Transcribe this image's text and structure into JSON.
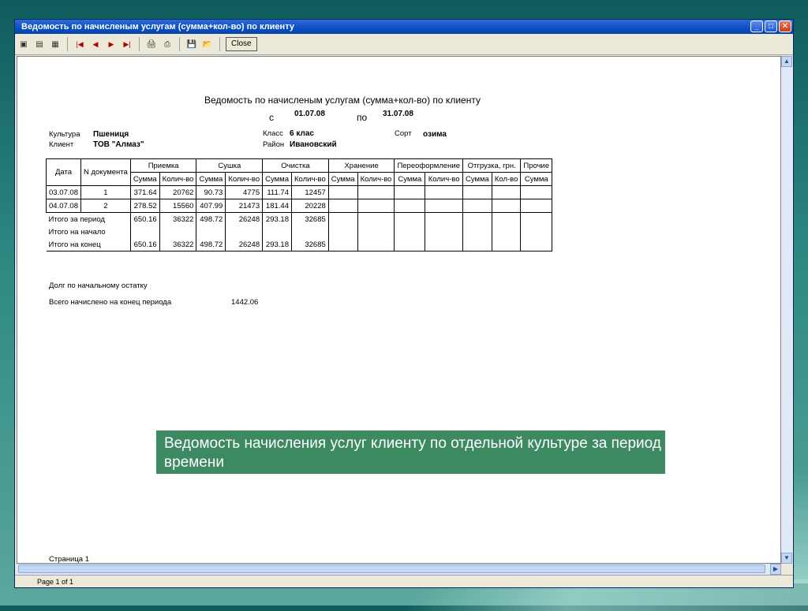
{
  "window": {
    "title": "Ведомость по начисленым услугам (сумма+кол-во) по клиенту",
    "close_label": "Close",
    "status": "Page 1 of 1"
  },
  "report": {
    "title": "Ведомость по начисленым услугам (сумма+кол-во) по клиенту",
    "from_label": "с",
    "from_date": "01.07.08",
    "to_label": "по",
    "to_date": "31.07.08",
    "culture_label": "Культура",
    "culture": "Пшениця",
    "client_label": "Клиент",
    "client": "ТОВ \"Алмаз\"",
    "class_label": "Класс",
    "class": "6 клас",
    "district_label": "Район",
    "district": "Ивановский",
    "sort_label": "Сорт",
    "sort": "озима",
    "headers": {
      "date": "Дата",
      "doc": "N документа",
      "g1": "Приемка",
      "g2": "Сушка",
      "g3": "Очистка",
      "g4": "Хранение",
      "g5": "Переоформление",
      "g6": "Отгрузка, грн.",
      "g7": "Прочие"
    },
    "sub": {
      "s1": "Сумма",
      "q1": "Колич-во",
      "s2": "Сумма",
      "q2": "Колич-во",
      "s3": "Сумма",
      "q3": "Колич-во",
      "s4": "Сумма",
      "q4": "Колич-во",
      "s5": "Сумма",
      "q5": "Колич-во",
      "s6": "Сумма",
      "q6": "Кол-во",
      "s7": "Сумма"
    },
    "rows": [
      {
        "date": "03.07.08",
        "doc": "1",
        "v1": "371.64",
        "v2": "20762",
        "v3": "90.73",
        "v4": "4775",
        "v5": "111.74",
        "v6": "12457"
      },
      {
        "date": "04.07.08",
        "doc": "2",
        "v1": "278.52",
        "v2": "15560",
        "v3": "407.99",
        "v4": "21473",
        "v5": "181.44",
        "v6": "20228"
      }
    ],
    "totals": [
      {
        "label": "Итого за период",
        "v1": "650.16",
        "v2": "36322",
        "v3": "498.72",
        "v4": "26248",
        "v5": "293.18",
        "v6": "32685"
      },
      {
        "label": "Итого на начало",
        "v1": "",
        "v2": "",
        "v3": "",
        "v4": "",
        "v5": "",
        "v6": ""
      },
      {
        "label": "Итого на конец",
        "v1": "650.16",
        "v2": "36322",
        "v3": "498.72",
        "v4": "26248",
        "v5": "293.18",
        "v6": "32685"
      }
    ],
    "debt_label": "Долг по начальному остатку",
    "total_accrued_label": "Всего начислено на конец периода",
    "total_accrued": "1442.06",
    "page_label": "Страница 1"
  },
  "caption": "Ведомость начисления услуг клиенту по отдельной культуре за период времени"
}
